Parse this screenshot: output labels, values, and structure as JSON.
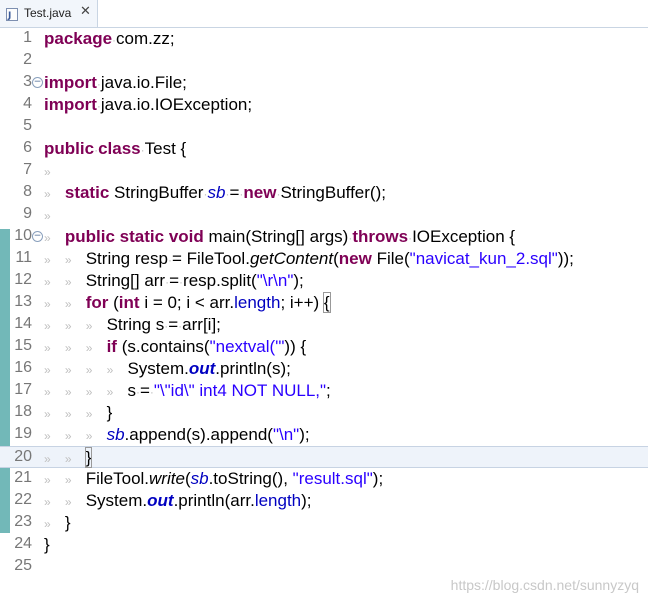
{
  "tab": {
    "title": "Test.java",
    "close_glyph": "✕",
    "icon": "java-file-icon"
  },
  "line_numbers": [
    "1",
    "2",
    "3",
    "4",
    "5",
    "6",
    "7",
    "8",
    "9",
    "10",
    "11",
    "12",
    "13",
    "14",
    "15",
    "16",
    "17",
    "18",
    "19",
    "20",
    "21",
    "22",
    "23",
    "24",
    "25"
  ],
  "fold_glyph": "⊖",
  "tokens": {
    "package": "package",
    "com_zz": "com.zz;",
    "import": "import",
    "java_io_file": "java.io.File;",
    "java_io_ioexception": "java.io.IOException;",
    "public": "public",
    "class": "class",
    "test_open": "Test {",
    "static": "static",
    "stringbuffer": "StringBuffer",
    "sb": "sb",
    "eq": "=",
    "new": "new",
    "stringbuffer_call": "StringBuffer();",
    "void": "void",
    "main_sig": "main(String[] args)",
    "throws": "throws",
    "ioexception_open": "IOException {",
    "string": "String",
    "resp": "resp",
    "filetool": "FileTool.",
    "getcontent": "getContent",
    "file_open": "File(",
    "navicat_str": "\"navicat_kun_2.sql\"",
    "close_paren_semi": "));",
    "string_arr": "String[]",
    "arr": "arr",
    "resp_split": "resp.split(",
    "rn_str": "\"\\r\\n\"",
    "paren_semi": ");",
    "for": "for",
    "int": "int",
    "i": "i",
    "for_mid1": "(",
    "for_mid2": " = 0;",
    "for_mid3": " < arr.",
    "length": "length",
    "for_mid4": "; i++)",
    "brace_open": "{",
    "s": "s",
    "arr_i": "arr[i];",
    "if": "if",
    "s_contains": "(s.contains(",
    "nextval_str": "\"nextval('\"",
    "if_close": ")) {",
    "system": "System.",
    "out": "out",
    "println_s": ".println(s);",
    "id_str": "\"\\\"id\\\" int4 NOT NULL,\"",
    "semi": ";",
    "brace_close": "}",
    "append_s": ".append(s).append(",
    "n_str": "\"\\n\"",
    "write": "write",
    "tostring": ".toString(),",
    "result_str": "\"result.sql\"",
    "println_arr": ".println(arr.",
    "length_close": ");",
    "tab_mark": "»",
    "space_mark": "·"
  },
  "watermark": "https://blog.csdn.net/sunnyzyq"
}
